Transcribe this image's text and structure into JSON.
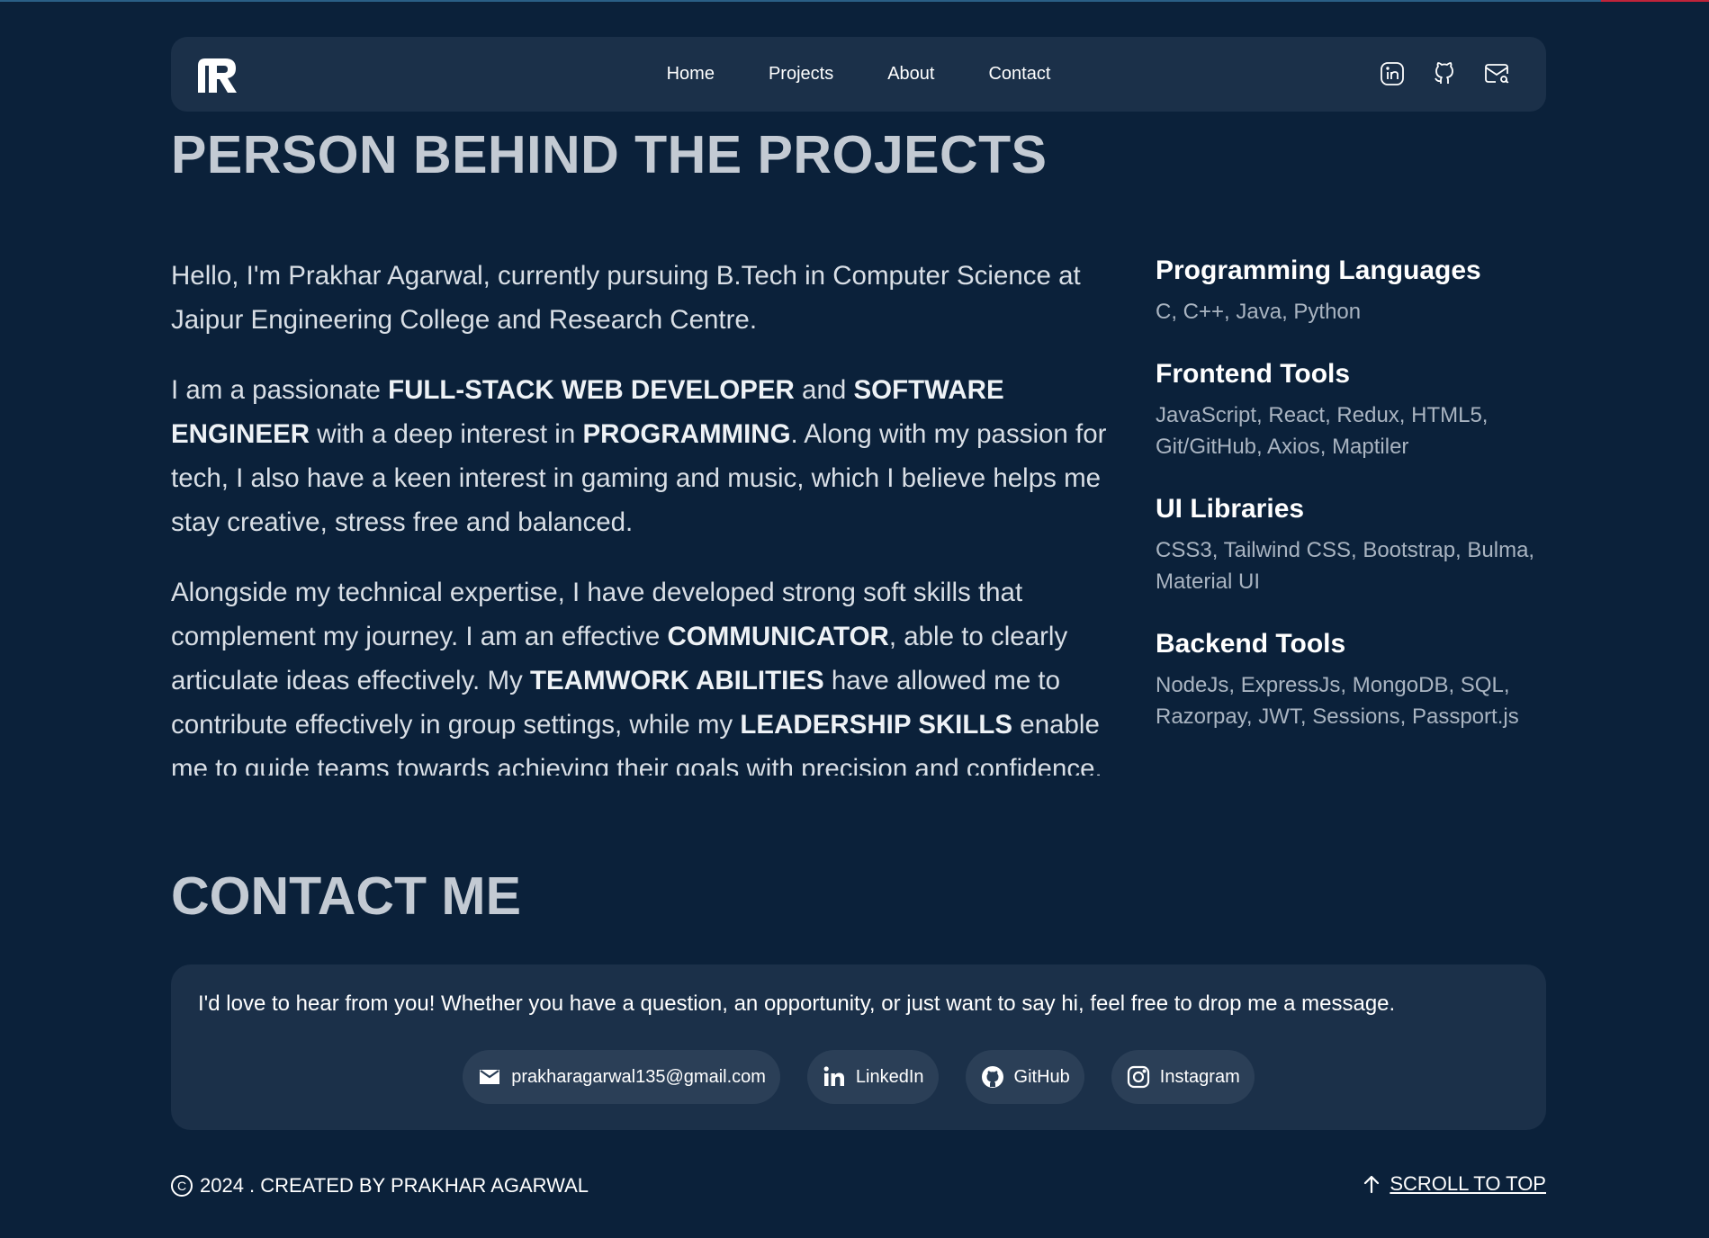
{
  "nav": {
    "links": [
      "Home",
      "Projects",
      "About",
      "Contact"
    ],
    "icons": [
      "linkedin-icon",
      "github-icon",
      "mail-icon"
    ]
  },
  "about": {
    "title": "PERSON BEHIND THE PROJECTS",
    "p1": "Hello, I'm Prakhar Agarwal, currently pursuing B.Tech in Computer Science at Jaipur Engineering College and Research Centre.",
    "p2": {
      "t1": "I am a passionate ",
      "b1": "FULL-STACK WEB DEVELOPER",
      "t2": " and ",
      "b2": "SOFTWARE ENGINEER",
      "t3": " with a deep interest in ",
      "b3": "PROGRAMMING",
      "t4": ". Along with my passion for tech, I also have a keen interest in gaming and music, which I believe helps me stay creative, stress free and balanced."
    },
    "p3": {
      "t1": "Alongside my technical expertise, I have developed strong soft skills that complement my journey. I am an effective ",
      "b1": "COMMUNICATOR",
      "t2": ", able to clearly articulate ideas effectively. My ",
      "b2": "TEAMWORK ABILITIES",
      "t3": " have allowed me to contribute effectively in group settings, while my ",
      "b3": "LEADERSHIP SKILLS",
      "t4": " enable me to guide teams towards achieving their goals with precision and confidence."
    }
  },
  "skills": [
    {
      "title": "Programming Languages",
      "items": "C, C++, Java, Python"
    },
    {
      "title": "Frontend Tools",
      "items": "JavaScript, React, Redux, HTML5, Git/GitHub, Axios, Maptiler"
    },
    {
      "title": "UI Libraries",
      "items": "CSS3, Tailwind CSS, Bootstrap, Bulma, Material UI"
    },
    {
      "title": "Backend Tools",
      "items": "NodeJs, ExpressJs, MongoDB, SQL, Razorpay, JWT, Sessions, Passport.js"
    }
  ],
  "contact": {
    "title": "CONTACT ME",
    "text": "I'd love to hear from you! Whether you have a question, an opportunity, or just want to say hi, feel free to drop me a message.",
    "buttons": [
      {
        "label": "prakharagarwal135@gmail.com",
        "icon": "mail-icon"
      },
      {
        "label": "LinkedIn",
        "icon": "linkedin-icon"
      },
      {
        "label": "GitHub",
        "icon": "github-icon"
      },
      {
        "label": "Instagram",
        "icon": "instagram-icon"
      }
    ]
  },
  "footer": {
    "copyright": "2024 . CREATED BY PRAKHAR AGARWAL",
    "copyright_symbol": "C",
    "scroll_top": "SCROLL TO TOP"
  },
  "colors": {
    "background": "#0b213a",
    "card": "#1b3049",
    "button": "#2b3f57",
    "heading": "#c3cad3"
  }
}
